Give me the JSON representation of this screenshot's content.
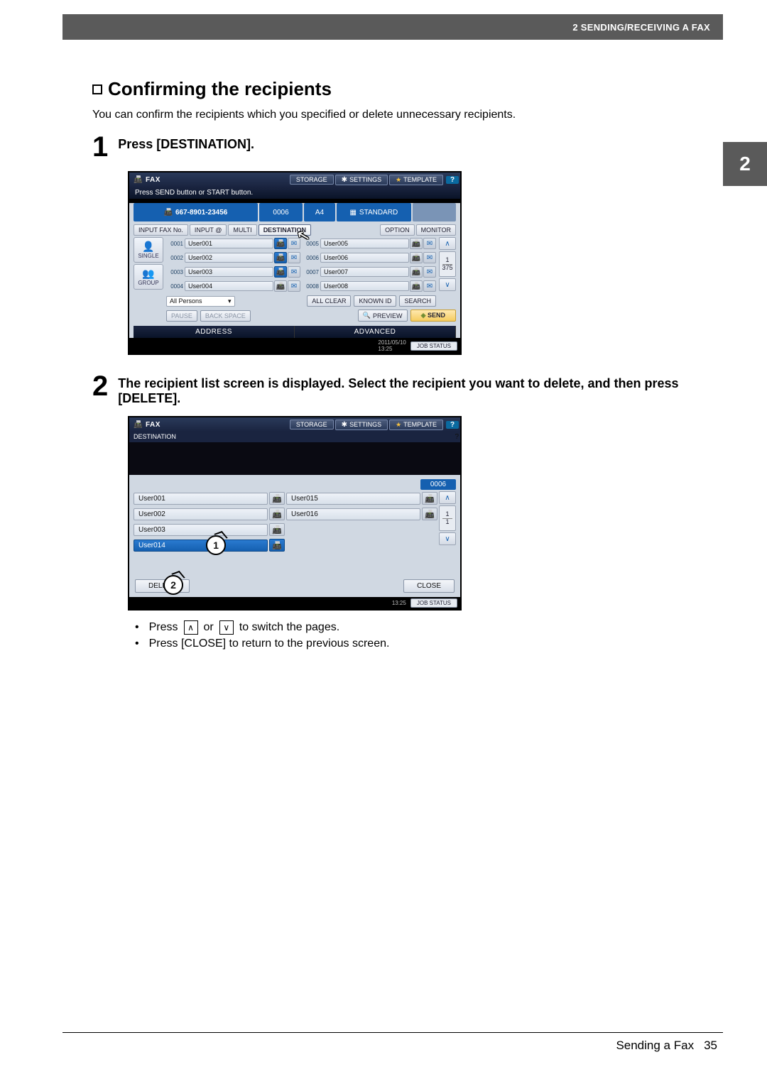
{
  "header": {
    "chapter": "2 SENDING/RECEIVING A FAX",
    "side_tab": "2"
  },
  "section": {
    "title": "Confirming the recipients",
    "intro": "You can confirm the recipients which you specified or delete unnecessary recipients."
  },
  "steps": {
    "s1": {
      "num": "1",
      "text": "Press [DESTINATION]."
    },
    "s2": {
      "num": "2",
      "text": "The recipient list screen is displayed. Select the recipient you want to delete, and then press [DELETE]."
    }
  },
  "bullets": {
    "b1a": "Press ",
    "b1b": " or ",
    "b1c": " to switch the pages.",
    "b2": "Press [CLOSE] to return to the previous screen."
  },
  "footer": {
    "label": "Sending a Fax",
    "page": "35"
  },
  "screen1": {
    "title": "FAX",
    "storage": "STORAGE",
    "settings": "SETTINGS",
    "template": "TEMPLATE",
    "help": "?",
    "subtitle": "Press SEND button or START button.",
    "status": {
      "fax_no": "667-8901-23456",
      "count": "0006",
      "paper": "A4",
      "mode": "STANDARD",
      "dim": ""
    },
    "tabs": {
      "input_fax": "INPUT FAX No.",
      "input_at": "INPUT @",
      "multi": "MULTI",
      "destination": "DESTINATION",
      "option": "OPTION",
      "monitor": "MONITOR"
    },
    "side": {
      "single": "SINGLE",
      "group": "GROUP"
    },
    "entries_left": [
      {
        "id": "0001",
        "name": "User001"
      },
      {
        "id": "0002",
        "name": "User002"
      },
      {
        "id": "0003",
        "name": "User003"
      },
      {
        "id": "0004",
        "name": "User004"
      }
    ],
    "entries_right": [
      {
        "id": "0005",
        "name": "User005"
      },
      {
        "id": "0006",
        "name": "User006"
      },
      {
        "id": "0007",
        "name": "User007"
      },
      {
        "id": "0008",
        "name": "User008"
      }
    ],
    "pager": {
      "cur": "1",
      "total": "375"
    },
    "filter": {
      "all": "All Persons",
      "allclear": "ALL CLEAR",
      "knownid": "KNOWN ID",
      "search": "SEARCH"
    },
    "actions": {
      "pause": "PAUSE",
      "backspace": "BACK SPACE",
      "preview": "PREVIEW",
      "send": "SEND"
    },
    "tabs_bottom": {
      "address": "ADDRESS",
      "advanced": "ADVANCED"
    },
    "footer": {
      "date": "2011/05/10",
      "time": "13:25",
      "job": "JOB STATUS"
    }
  },
  "screen2": {
    "title": "FAX",
    "storage": "STORAGE",
    "settings": "SETTINGS",
    "template": "TEMPLATE",
    "help": "?",
    "sub": "DESTINATION",
    "help2": "?",
    "count": "0006",
    "left": [
      {
        "name": "User001",
        "sel": false
      },
      {
        "name": "User002",
        "sel": false
      },
      {
        "name": "User003",
        "sel": false
      },
      {
        "name": "User014",
        "sel": true
      }
    ],
    "right": [
      {
        "name": "User015"
      },
      {
        "name": "User016"
      }
    ],
    "pager": {
      "cur": "1",
      "total": "1"
    },
    "delete": "DELETE",
    "close": "CLOSE",
    "footer": {
      "time": "13:25",
      "job": "JOB STATUS"
    },
    "callout1": "1",
    "callout2": "2"
  }
}
